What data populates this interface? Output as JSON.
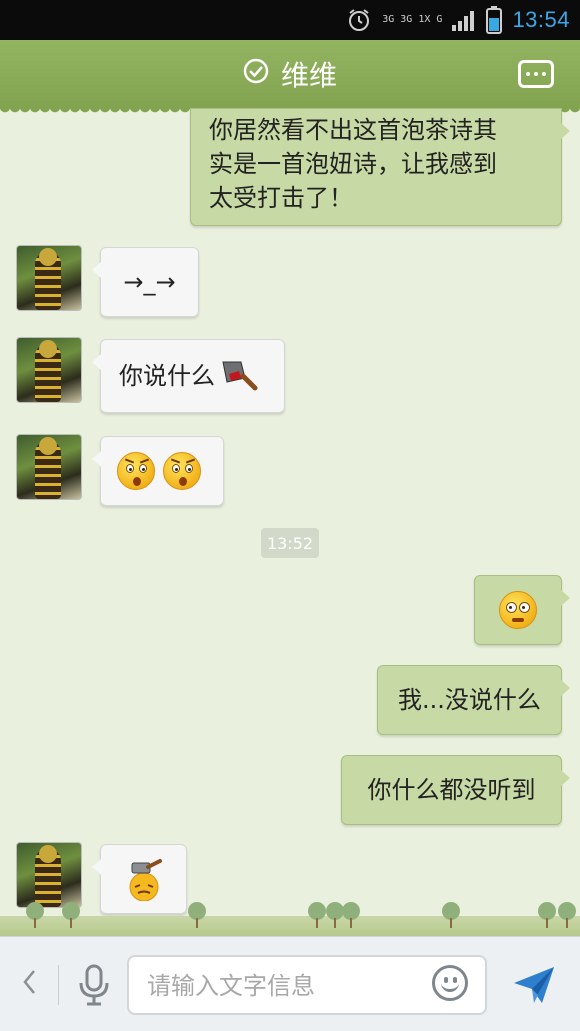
{
  "status_bar": {
    "network_label": "3G 3G 1X G",
    "time": "13:54",
    "icons": [
      "alarm-icon",
      "network-icon",
      "signal-icon",
      "battery-icon"
    ]
  },
  "header": {
    "title": "维维",
    "status_icon": "check-circle-icon",
    "menu_icon": "more-menu-icon"
  },
  "messages": [
    {
      "side": "right",
      "type": "text",
      "text_lines": [
        "你居然看不出这首泡茶诗其",
        "实是一首泡妞诗，让我感到",
        "太受打击了！"
      ]
    },
    {
      "side": "left",
      "type": "text",
      "text": "→_→"
    },
    {
      "side": "left",
      "type": "text_emoji",
      "text": "你说什么",
      "emoji": "cleaver-icon"
    },
    {
      "side": "left",
      "type": "emoji",
      "emoji": [
        "shocked-face-icon",
        "shocked-face-icon"
      ]
    },
    {
      "side": "right",
      "type": "emoji",
      "emoji": [
        "rolling-eyes-face-icon"
      ]
    },
    {
      "side": "right",
      "type": "text",
      "text": "我...没说什么"
    },
    {
      "side": "right",
      "type": "text",
      "text": "你什么都没听到"
    },
    {
      "side": "left",
      "type": "emoji",
      "emoji": [
        "hammer-hit-face-icon"
      ]
    }
  ],
  "timestamp": "13:52",
  "input_bar": {
    "placeholder": "请输入文字信息",
    "back_icon": "chevron-left-icon",
    "mic_icon": "microphone-icon",
    "emoji_icon": "smiley-icon",
    "send_icon": "send-icon"
  },
  "colors": {
    "header_green": "#8bab59",
    "chat_background": "#e9f0dd",
    "outgoing_bubble": "#c7d9a4",
    "incoming_bubble": "#f6f6f6",
    "time_blue": "#3aa7e8"
  }
}
